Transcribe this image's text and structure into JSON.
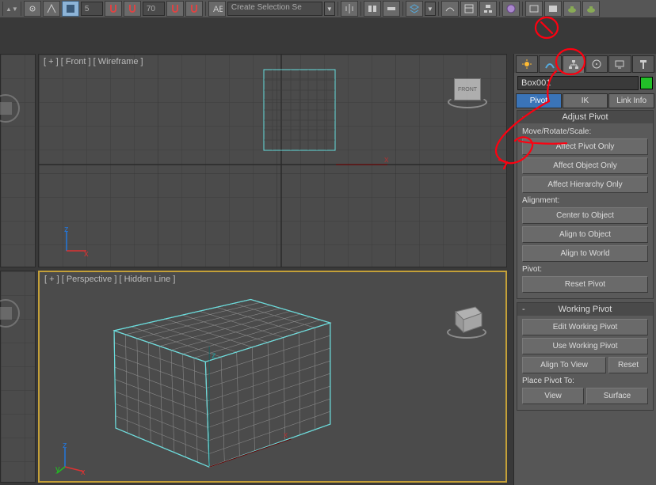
{
  "toolbar": {
    "spinner1": "5",
    "spinner2": "70",
    "dropdown": "Create Selection Se"
  },
  "viewports": {
    "front": "[ + ] [ Front ] [ Wireframe ]",
    "perspective": "[ + ] [ Perspective ] [ Hidden Line ]",
    "cube_front": "FRONT"
  },
  "panel": {
    "object_name": "Box001",
    "subtabs": {
      "pivot": "Pivot",
      "ik": "IK",
      "link_info": "Link Info"
    },
    "adjust_pivot": {
      "title": "Adjust Pivot",
      "move_label": "Move/Rotate/Scale:",
      "affect_pivot": "Affect Pivot Only",
      "affect_object": "Affect Object Only",
      "affect_hierarchy": "Affect Hierarchy Only",
      "alignment_label": "Alignment:",
      "center_to_object": "Center to Object",
      "align_to_object": "Align to Object",
      "align_to_world": "Align to World",
      "pivot_label": "Pivot:",
      "reset_pivot": "Reset Pivot"
    },
    "working_pivot": {
      "title": "Working Pivot",
      "edit": "Edit Working Pivot",
      "use": "Use Working Pivot",
      "align_to_view": "Align To View",
      "reset": "Reset",
      "place_label": "Place Pivot To:",
      "view": "View",
      "surface": "Surface"
    }
  }
}
